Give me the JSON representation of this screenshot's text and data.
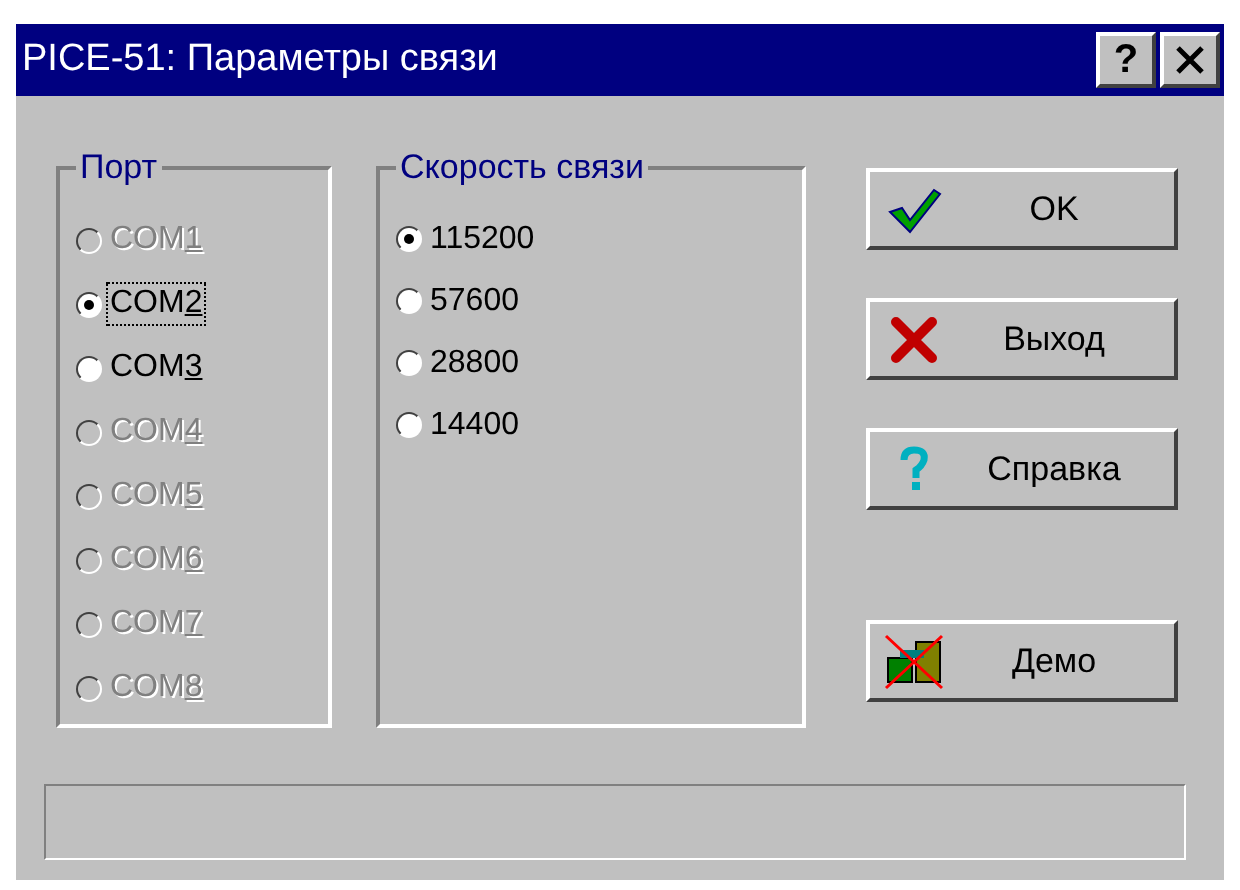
{
  "window": {
    "title": "PICE-51: Параметры связи",
    "help_button": "?"
  },
  "port_group": {
    "label": "Порт",
    "options": [
      {
        "label": "COM1",
        "selected": false,
        "disabled": true,
        "focused": false
      },
      {
        "label": "COM2",
        "selected": true,
        "disabled": false,
        "focused": true
      },
      {
        "label": "COM3",
        "selected": false,
        "disabled": false,
        "focused": false
      },
      {
        "label": "COM4",
        "selected": false,
        "disabled": true,
        "focused": false
      },
      {
        "label": "COM5",
        "selected": false,
        "disabled": true,
        "focused": false
      },
      {
        "label": "COM6",
        "selected": false,
        "disabled": true,
        "focused": false
      },
      {
        "label": "COM7",
        "selected": false,
        "disabled": true,
        "focused": false
      },
      {
        "label": "COM8",
        "selected": false,
        "disabled": true,
        "focused": false
      }
    ]
  },
  "speed_group": {
    "label": "Скорость связи",
    "options": [
      {
        "label": "115200",
        "selected": true
      },
      {
        "label": "57600",
        "selected": false
      },
      {
        "label": "28800",
        "selected": false
      },
      {
        "label": "14400",
        "selected": false
      }
    ]
  },
  "buttons": [
    {
      "label": "OK",
      "kind": "check"
    },
    {
      "label": "Выход",
      "kind": "cross"
    },
    {
      "label": "Справка",
      "kind": "help"
    },
    {
      "label": "Демо",
      "kind": "demo"
    }
  ]
}
